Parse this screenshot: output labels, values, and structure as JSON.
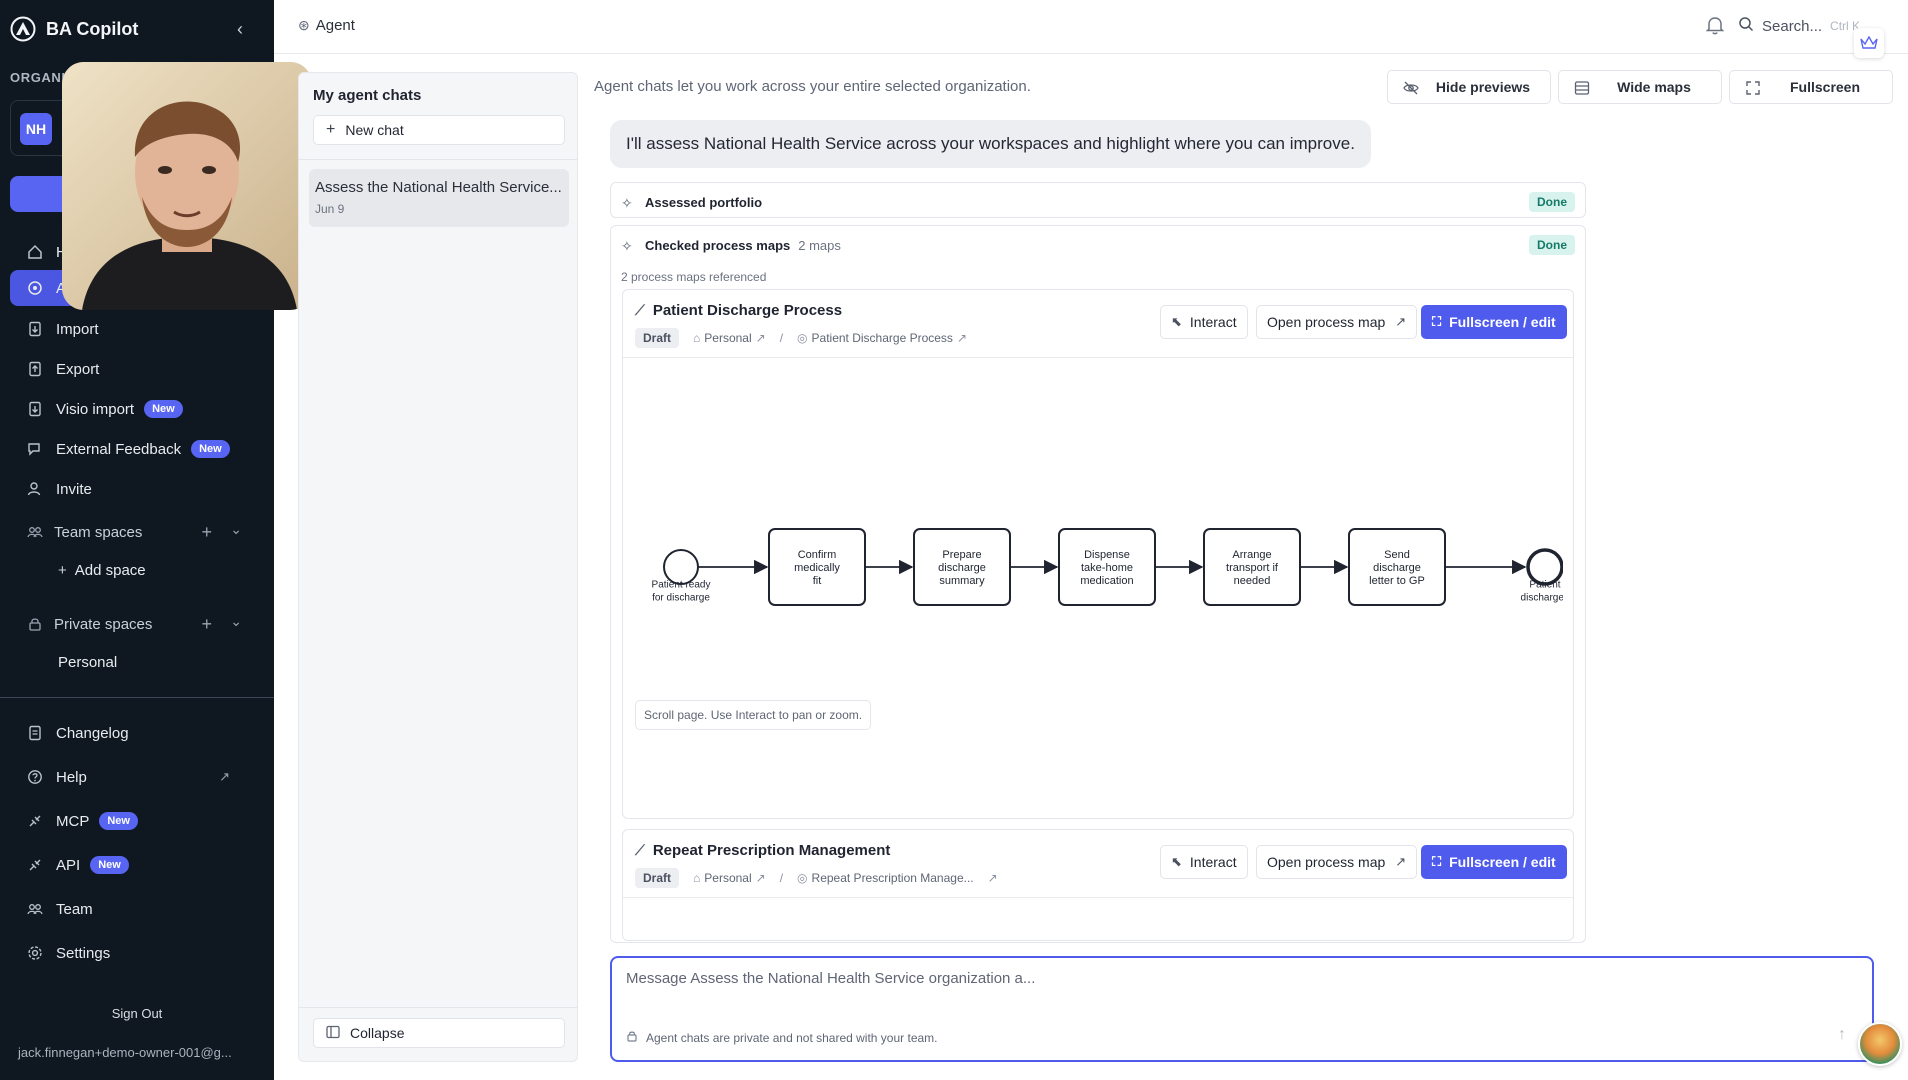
{
  "app": {
    "title": "BA Copilot"
  },
  "sidebar": {
    "org_label": "ORGANIZ",
    "org_initials": "NH",
    "items": [
      {
        "label": "H",
        "icon": "home-icon"
      },
      {
        "label": "Ag",
        "icon": "agent-icon"
      },
      {
        "label": "Import",
        "icon": "import-icon"
      },
      {
        "label": "Export",
        "icon": "export-icon"
      },
      {
        "label": "Visio import",
        "icon": "visio-icon",
        "badge": "New"
      },
      {
        "label": "External Feedback",
        "icon": "feedback-icon",
        "badge": "New"
      },
      {
        "label": "Invite",
        "icon": "invite-icon"
      }
    ],
    "team_spaces": {
      "label": "Team spaces",
      "add_space": "Add space"
    },
    "private_spaces": {
      "label": "Private spaces",
      "personal": "Personal"
    },
    "bottom_items": [
      {
        "label": "Changelog",
        "icon": "changelog-icon"
      },
      {
        "label": "Help",
        "icon": "help-icon"
      },
      {
        "label": "MCP",
        "icon": "mcp-icon",
        "badge": "New"
      },
      {
        "label": "API",
        "icon": "api-icon",
        "badge": "New"
      },
      {
        "label": "Team",
        "icon": "team-icon"
      },
      {
        "label": "Settings",
        "icon": "settings-icon"
      }
    ],
    "sign_out": "Sign Out",
    "email": "jack.finnegan+demo-owner-001@g..."
  },
  "topbar": {
    "breadcrumb": "Agent",
    "search_label": "Search...",
    "search_shortcut": "Ctrl K"
  },
  "chat_list": {
    "title": "My agent chats",
    "new_chat": "New chat",
    "items": [
      {
        "title": "Assess the National Health Service...",
        "date": "Jun 9"
      }
    ],
    "collapse": "Collapse"
  },
  "main": {
    "intro": "Agent chats let you work across your entire selected organization.",
    "toolbar": {
      "hide_previews": "Hide previews",
      "wide_maps": "Wide maps",
      "fullscreen": "Fullscreen"
    },
    "user_message": "I'll assess National Health Service across your workspaces and highlight where you can improve.",
    "steps": [
      {
        "title": "Assessed portfolio",
        "status": "Done"
      },
      {
        "title": "Checked process maps",
        "count": "2 maps",
        "status": "Done",
        "refs": "2 process maps referenced"
      }
    ],
    "maps": [
      {
        "title": "Patient Discharge Process",
        "status": "Draft",
        "space": "Personal",
        "link": "Patient Discharge Process",
        "buttons": {
          "interact": "Interact",
          "open": "Open process map",
          "fullscreen": "Fullscreen / edit"
        },
        "diagram": {
          "start": "Patient ready for discharge",
          "tasks": [
            "Confirm medically fit",
            "Prepare discharge summary",
            "Dispense take-home medication",
            "Arrange transport if needed",
            "Send discharge letter to GP"
          ],
          "end": "Patient discharged"
        },
        "hint": "Scroll page. Use Interact to pan or zoom."
      },
      {
        "title": "Repeat Prescription Management",
        "status": "Draft",
        "space": "Personal",
        "link": "Repeat Prescription Manage...",
        "buttons": {
          "interact": "Interact",
          "open": "Open process map",
          "fullscreen": "Fullscreen / edit"
        }
      }
    ],
    "composer": {
      "placeholder": "Message Assess the National Health Service organization a...",
      "note": "Agent chats are private and not shared with your team."
    }
  },
  "colors": {
    "sidebar_bg": "#0f1720",
    "accent": "#4f5bed",
    "done_bg": "#d8f3ee",
    "done_text": "#167a69"
  }
}
